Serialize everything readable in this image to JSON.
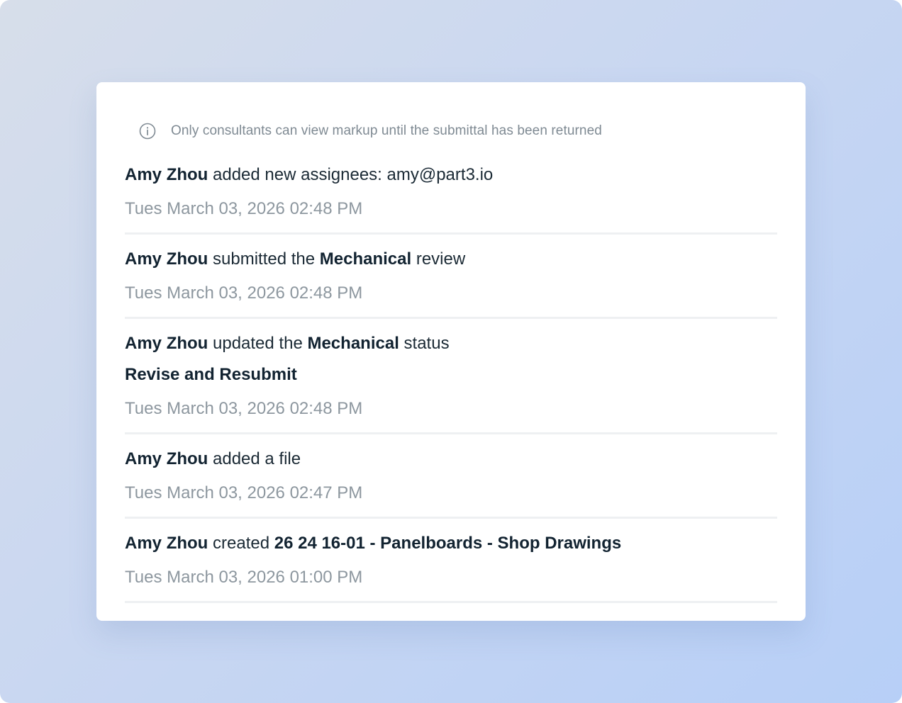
{
  "notice": {
    "icon": "info-icon",
    "text": "Only consultants can view markup until the submittal has been returned"
  },
  "activity": [
    {
      "actor": "Amy Zhou",
      "action": "added new assignees: amy@part3.io",
      "timestamp": "Tues March 03, 2026 02:48 PM"
    },
    {
      "actor": "Amy Zhou",
      "action_before": "submitted the",
      "subject": "Mechanical",
      "action_after": "review",
      "timestamp": "Tues March 03, 2026 02:48 PM"
    },
    {
      "actor": "Amy Zhou",
      "action_before": "updated the",
      "subject": "Mechanical",
      "action_after": "status",
      "status": "Revise and Resubmit",
      "timestamp": "Tues March 03, 2026 02:48 PM"
    },
    {
      "actor": "Amy Zhou",
      "action": "added a file",
      "timestamp": "Tues March 03, 2026 02:47 PM"
    },
    {
      "actor": "Amy Zhou",
      "action_before": "created",
      "subject": "26 24 16-01 - Panelboards - Shop Drawings",
      "timestamp": "Tues March 03, 2026 01:00 PM"
    }
  ]
}
